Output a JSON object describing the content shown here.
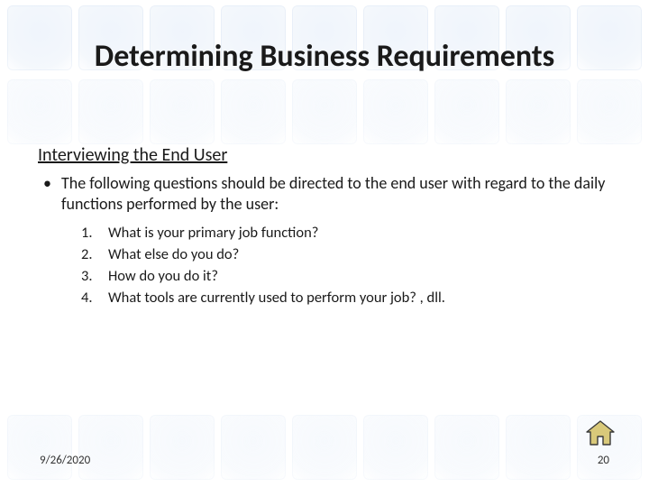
{
  "title": "Determining Business Requirements",
  "subheading": "Interviewing the End User",
  "bullet": "The following questions should be directed to the end user with regard to the daily functions performed by the user:",
  "questions": {
    "n1": "1.",
    "q1": "What is your primary job function?",
    "n2": "2.",
    "q2": "What else do you do?",
    "n3": "3.",
    "q3": "How do you do it?",
    "n4": "4.",
    "q4": "What tools are currently used to perform your job? , dll."
  },
  "footer": {
    "date": "9/26/2020",
    "page": "20"
  },
  "icons": {
    "home": "home-icon"
  }
}
